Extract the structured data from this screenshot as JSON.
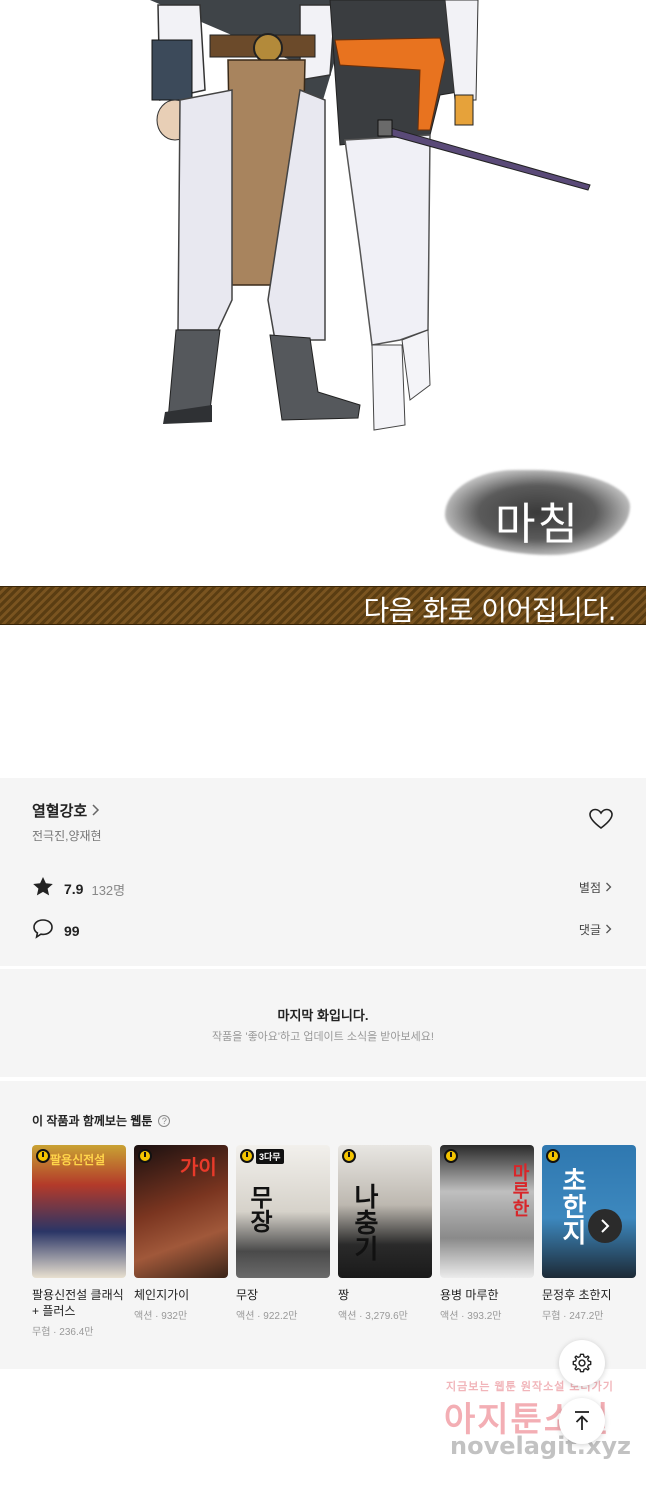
{
  "comic": {
    "end_stamp": "마침",
    "next_banner": "다음 화로 이어집니다."
  },
  "info": {
    "title": "열혈강호",
    "author": "전극진,양재현",
    "rating": "7.9",
    "rating_count": "132명",
    "rate_link": "별점",
    "comments": "99",
    "comment_link": "댓글"
  },
  "last_episode": {
    "heading": "마지막 화입니다.",
    "sub": "작품을 '좋아요'하고 업데이트 소식을 받아보세요!"
  },
  "recommendations": {
    "heading": "이 작품과 함께보는 웹툰",
    "items": [
      {
        "name": "팔용신전설 클래식 + 플러스",
        "meta": "무협 · 236.4만",
        "cover_text": "팔용신전설",
        "cover_color": "#2c2a28"
      },
      {
        "name": "체인지가이",
        "meta": "액션 · 932만",
        "cover_text": "가이",
        "cover_color": "#5a2a1a"
      },
      {
        "name": "무장",
        "meta": "액션 · 922.2만",
        "cover_text": "무장",
        "cover_color": "#d9d6cf",
        "tag": "3다무"
      },
      {
        "name": "짱",
        "meta": "액션 · 3,279.6만",
        "cover_text": "나충기",
        "cover_color": "#cfcac3"
      },
      {
        "name": "용병 마루한",
        "meta": "액션 · 393.2만",
        "cover_text": "마루한",
        "cover_color": "#3a3a3a"
      },
      {
        "name": "문정후 초한지",
        "meta": "무협 · 247.2만",
        "cover_text": "초한지",
        "cover_color": "#2c6fa0"
      }
    ]
  },
  "watermark": {
    "line1": "지금보는 웹툰 원작소설 보러가기",
    "line2": "아지툰소설",
    "line3": "novelagit.xyz"
  }
}
